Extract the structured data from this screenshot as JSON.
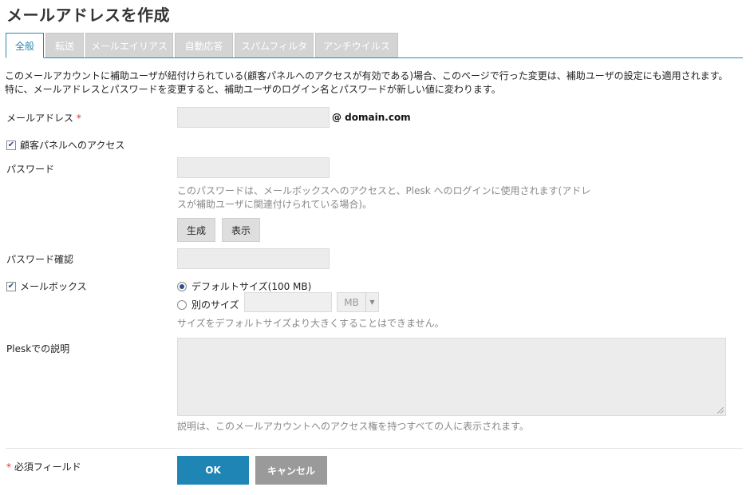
{
  "page": {
    "title": "メールアドレスを作成"
  },
  "tabs": [
    {
      "label": "全般",
      "active": true
    },
    {
      "label": "転送"
    },
    {
      "label": "メールエイリアス"
    },
    {
      "label": "自動応答"
    },
    {
      "label": "スパムフィルタ"
    },
    {
      "label": "アンチウイルス"
    }
  ],
  "notice": {
    "line1": "このメールアカウントに補助ユーザが紐付けられている(顧客パネルへのアクセスが有効である)場合、このページで行った変更は、補助ユーザの設定にも適用されます。",
    "line2": "特に、メールアドレスとパスワードを変更すると、補助ユーザのログイン名とパスワードが新しい値に変わります。"
  },
  "form": {
    "email_label": "メールアドレス",
    "required_mark": "*",
    "email_value": "",
    "domain_suffix": "@ domain.com",
    "customer_panel_access_label": "顧客パネルへのアクセス",
    "customer_panel_access_checked": true,
    "password_label": "パスワード",
    "password_value": "",
    "password_hint_line1": "このパスワードは、メールボックスへのアクセスと、Plesk へのログインに使用されます(アドレ",
    "password_hint_line2": "スが補助ユーザに関連付けられている場合)。",
    "generate_label": "生成",
    "show_label": "表示",
    "confirm_password_label": "パスワード確認",
    "confirm_password_value": "",
    "mailbox_label": "メールボックス",
    "mailbox_checked": true,
    "default_size_label": "デフォルトサイズ(100 MB)",
    "custom_size_label": "別のサイズ",
    "custom_size_value": "",
    "size_unit": "MB",
    "size_hint": "サイズをデフォルトサイズより大きくすることはできません。",
    "description_label": "Pleskでの説明",
    "description_value": "",
    "description_hint": "説明は、このメールアカウントへのアクセス権を持つすべての人に表示されます。",
    "required_fields_label": "必須フィールド"
  },
  "buttons": {
    "ok": "OK",
    "cancel": "キャンセル"
  },
  "colors": {
    "accent": "#1f85b5",
    "required": "#d23a3a",
    "cancel": "#9a9a9a"
  }
}
